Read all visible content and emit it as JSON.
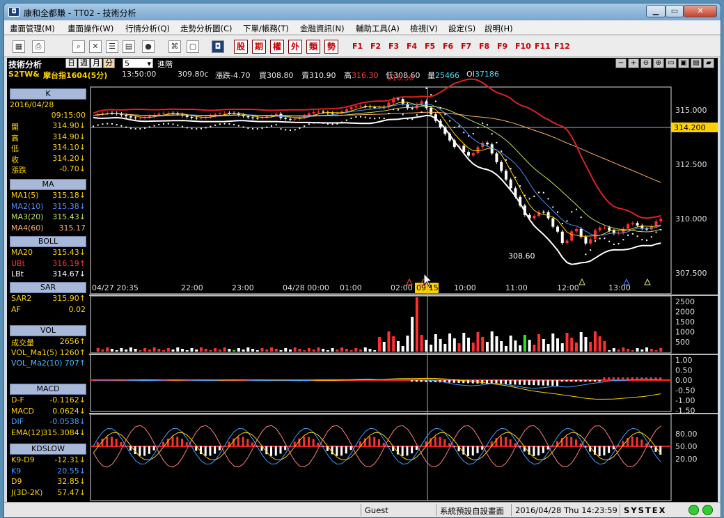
{
  "window": {
    "title": "康和全都賺 - TT02 - 技術分析",
    "app_icon": "app-logo-icon",
    "minimize": "minimize-icon",
    "maximize": "maximize-icon",
    "close": "close-icon"
  },
  "menu": [
    "畫面管理(M)",
    "畫面操作(W)",
    "行情分析(Q)",
    "走勢分析圖(C)",
    "下單/帳務(T)",
    "金融資訊(N)",
    "輔助工具(A)",
    "檢視(V)",
    "設定(S)",
    "說明(H)"
  ],
  "toolbar": {
    "red_buttons": [
      "股",
      "期",
      "權",
      "外",
      "類",
      "勢"
    ],
    "fkeys": [
      "F1",
      "F2",
      "F3",
      "F4",
      "F5",
      "F6",
      "F7",
      "F8",
      "F9",
      "F10",
      "F11",
      "F12"
    ]
  },
  "header": {
    "panel_title": "技術分析",
    "periods": [
      "日",
      "週",
      "月",
      "分"
    ],
    "interval": "5",
    "advanced": "進階"
  },
  "quote": {
    "symbol": "S2TW&",
    "name": "摩台指1604(5分)",
    "time": "13:50:00",
    "last": "309.80c",
    "change_label": "漲跌",
    "change": "-4.70",
    "bid_label": "買",
    "bid": "308.80",
    "ask_label": "賣",
    "ask": "310.90",
    "high_label": "高",
    "high": "316.30",
    "low_label": "低",
    "low": "308.60",
    "vol_label": "量",
    "vol": "25466",
    "oi_label": "OI",
    "oi": "37186"
  },
  "left_panel": {
    "k": {
      "title": "K",
      "date": "2016/04/28",
      "time": "09:15:00",
      "rows": [
        [
          "開",
          "314.90↓"
        ],
        [
          "高",
          "314.90↓"
        ],
        [
          "低",
          "314.10↓"
        ],
        [
          "收",
          "314.20↓"
        ],
        [
          "漲跌",
          "-0.70↓"
        ]
      ]
    },
    "ma": {
      "title": "MA",
      "rows": [
        [
          "MA1(5)",
          "315.18↓"
        ],
        [
          "MA2(10)",
          "315.38↓"
        ],
        [
          "MA3(20)",
          "315.43↓"
        ],
        [
          "MA4(60)",
          "315.17"
        ]
      ]
    },
    "boll": {
      "title": "BOLL",
      "rows": [
        [
          "MA20",
          "315.43↓"
        ],
        [
          "UBt",
          "316.19↑"
        ],
        [
          "LBt",
          "314.67↓"
        ]
      ]
    },
    "sar": {
      "title": "SAR",
      "rows": [
        [
          "SAR2",
          "315.90↑"
        ],
        [
          "AF",
          "0.02"
        ]
      ]
    },
    "vol": {
      "title": "VOL",
      "rows": [
        [
          "成交量",
          "2656↑"
        ],
        [
          "VOL_Ma1(5)",
          "1260↑"
        ],
        [
          "VOL_Ma2(10)",
          "707↑"
        ]
      ]
    },
    "macd": {
      "title": "MACD",
      "rows": [
        [
          "D-F",
          "-0.1162↓"
        ],
        [
          "MACD",
          "0.0624↓"
        ],
        [
          "DIF",
          "-0.0538↓"
        ],
        [
          "EMA(12)",
          "315.3084↓"
        ]
      ]
    },
    "kd": {
      "title": "KDSLOW",
      "rows": [
        [
          "K9-D9",
          "-12.31↓"
        ],
        [
          "K9",
          "20.55↓"
        ],
        [
          "D9",
          "32.85↓"
        ],
        [
          "J(3D-2K)",
          "57.47↓"
        ]
      ]
    }
  },
  "chart": {
    "price_axis": [
      "315.000",
      "312.500",
      "310.000",
      "307.500"
    ],
    "cursor_price": "314.200",
    "time_axis": [
      "04/27 20:35",
      "22:00",
      "23:00",
      "04/28 00:00",
      "01:00",
      "02:00",
      "09:15",
      "10:00",
      "11:00",
      "12:00",
      "13:00"
    ],
    "high_label": "316.30",
    "low_label": "308.60",
    "vol_axis": [
      "2500",
      "2000",
      "1500",
      "1000",
      "500"
    ],
    "macd_axis": [
      "1.00",
      "0.50",
      "0.00",
      "-0.50",
      "-1.00",
      "-1.50"
    ],
    "kd_axis": [
      "80.00",
      "50.00",
      "20.00"
    ]
  },
  "chart_data": {
    "type": "candlestick",
    "ylim": [
      307.0,
      317.2
    ],
    "highlights": {
      "high": 316.3,
      "low": 308.6,
      "cursor_time": "09:15",
      "cursor_price": 314.2
    }
  },
  "status": {
    "user": "Guest",
    "layout": "系統預設自設畫面",
    "datetime": "2016/04/28 Thu 14:23:59",
    "brand": "SYSTEX"
  }
}
